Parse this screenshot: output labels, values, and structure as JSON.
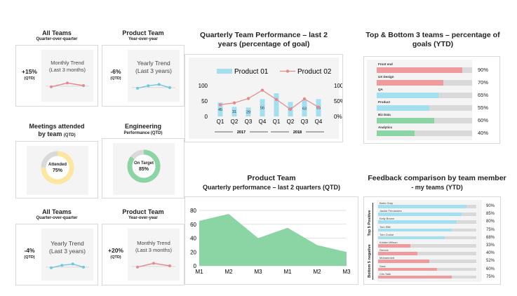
{
  "kpi_cards": [
    {
      "title": "All Teams",
      "subtitle": "Quarter-over-quarter",
      "value": "+15%",
      "qtd": "(QTD)",
      "trend_line1": "Monthly Trend",
      "trend_line2": "(Last 3 months)",
      "color": "#e5898a",
      "trend": [
        0.4,
        0.7,
        0.5
      ]
    },
    {
      "title": "Product Team",
      "subtitle": "Year-over-year",
      "value": "-6%",
      "qtd": "(QTD)",
      "trend_line1": "Yearly Trend",
      "trend_line2": "(Last 3 years)",
      "color": "#6cc7e0",
      "trend": [
        0.4,
        0.6,
        0.7,
        0.45
      ]
    },
    {
      "title": "All Teams",
      "subtitle": "Quarter-over-quarter",
      "value": "-4%",
      "qtd": "(QTD)",
      "trend_line1": "Yearly Trend",
      "trend_line2": "(Last 3 years)",
      "color": "#6cc7e0",
      "trend": [
        0.4,
        0.6,
        0.7,
        0.45
      ]
    },
    {
      "title": "Product Team",
      "subtitle": "Year-over-year",
      "value": "+20%",
      "qtd": "(QTD)",
      "trend_line1": "Monthly Trend",
      "trend_line2": "(Last 3 months)",
      "color": "#e5898a",
      "trend": [
        0.4,
        0.7,
        0.5
      ]
    }
  ],
  "donuts": [
    {
      "title_line1": "Meetings attended",
      "title_line2": "by team",
      "title_suffix": "(QTD)",
      "center_line1": "Attended",
      "center_line2": "75%",
      "value": 0.75,
      "color": "#fde7a0",
      "center_color": "#ffffff"
    },
    {
      "title_line1": "Engineering",
      "title_line2": "Performance (QTD)",
      "title_suffix": "",
      "center_line1": "On Target",
      "center_line2": "85%",
      "value": 0.85,
      "color": "#8ad5a3",
      "center_color": "#ffffff"
    }
  ],
  "quarterly": {
    "title_line1": "Quarterly Team Performance – last 2",
    "title_line2": "years (percentage of goal)",
    "legend": [
      "Product 01",
      "Product 02"
    ],
    "colors": {
      "bar": "#a3dff0",
      "line": "#e5898a"
    }
  },
  "top_bottom": {
    "title_line1": "Top & Bottom 3 teams – percentage of",
    "title_line2": "goals (YTD)",
    "teams": [
      {
        "name": "Front end",
        "pct": "90%",
        "value": 0.9,
        "color": "#ef9a9c"
      },
      {
        "name": "UX Design",
        "pct": "70%",
        "value": 0.7,
        "color": "#ef9a9c"
      },
      {
        "name": "QA",
        "pct": "65%",
        "value": 0.65,
        "color": "#a3dff0"
      },
      {
        "name": "Product",
        "pct": "55%",
        "value": 0.55,
        "color": "#a3dff0"
      },
      {
        "name": "Biz Data",
        "pct": "60%",
        "value": 0.6,
        "color": "#8ad5a3"
      },
      {
        "name": "Analytics",
        "pct": "40%",
        "value": 0.4,
        "color": "#8ad5a3"
      }
    ]
  },
  "product_team": {
    "title_line1": "Product Team",
    "title_line2": "Quarterly performance – last 2 quarters (QTD)",
    "color": "#8ad5a3"
  },
  "feedback": {
    "title_line1": "Feedback comparison by team member",
    "title_line2": "- my teams (YTD)",
    "top_label": "Top 5 Positive",
    "bottom_label": "Bottom 5 negative",
    "members": [
      {
        "name": "Barlo Gray",
        "pct": "90%",
        "value": 0.9,
        "color": "#a3dff0"
      },
      {
        "name": "Jackie Fernandes",
        "pct": "85%",
        "value": 0.85,
        "color": "#a3dff0"
      },
      {
        "name": "Kelly Brown",
        "pct": "80%",
        "value": 0.8,
        "color": "#a3dff0"
      },
      {
        "name": "Tom Stitt",
        "pct": "75%",
        "value": 0.75,
        "color": "#a3dff0"
      },
      {
        "name": "Tom Cruise",
        "pct": "68%",
        "value": 0.68,
        "color": "#a3dff0"
      },
      {
        "name": "Kristen Wilson",
        "pct": "33%",
        "value": 0.33,
        "color": "#ef9a9c"
      },
      {
        "name": "Dereck",
        "pct": "40%",
        "value": 0.4,
        "color": "#ef9a9c"
      },
      {
        "name": "Mohammed",
        "pct": "52%",
        "value": 0.52,
        "color": "#ef9a9c"
      },
      {
        "name": "Sara",
        "pct": "60%",
        "value": 0.6,
        "color": "#ef9a9c"
      },
      {
        "name": "Cris Salk",
        "pct": "75%",
        "value": 0.75,
        "color": "#ef9a9c"
      }
    ]
  },
  "chart_data": [
    {
      "type": "bar",
      "title": "Quarterly Team Performance – last 2 years (percentage of goal)",
      "categories": [
        "Q1",
        "Q2",
        "Q3",
        "Q4",
        "Q1",
        "Q2",
        "Q3",
        "Q4"
      ],
      "groups": [
        "2017",
        "2018"
      ],
      "series": [
        {
          "name": "Product 01",
          "type": "bar",
          "axis": "left",
          "values": [
            45,
            31,
            29,
            56,
            75,
            47,
            53,
            56
          ],
          "labels": [
            "45",
            "31",
            "29",
            "56",
            "",
            "47",
            "63",
            "56"
          ]
        },
        {
          "name": "Product 02",
          "type": "line",
          "axis": "right",
          "values": [
            38,
            44,
            58,
            85,
            55,
            23,
            57,
            30
          ]
        }
      ],
      "ylim": [
        0,
        100
      ],
      "yticks": [
        "0",
        "50",
        "100"
      ],
      "y2lim": [
        0,
        100
      ],
      "y2ticks": [
        "0%",
        "50%",
        "100%"
      ],
      "legend": "top"
    },
    {
      "type": "area",
      "title": "Product Team – Quarterly performance – last 2 quarters (QTD)",
      "categories": [
        "M1",
        "M2",
        "M3",
        "M1",
        "M2",
        "M3"
      ],
      "values": [
        65,
        75,
        40,
        55,
        30,
        20
      ],
      "ylim": [
        0,
        80
      ],
      "yticks": [
        "0",
        "20",
        "40",
        "60",
        "80"
      ],
      "grid": true
    }
  ]
}
